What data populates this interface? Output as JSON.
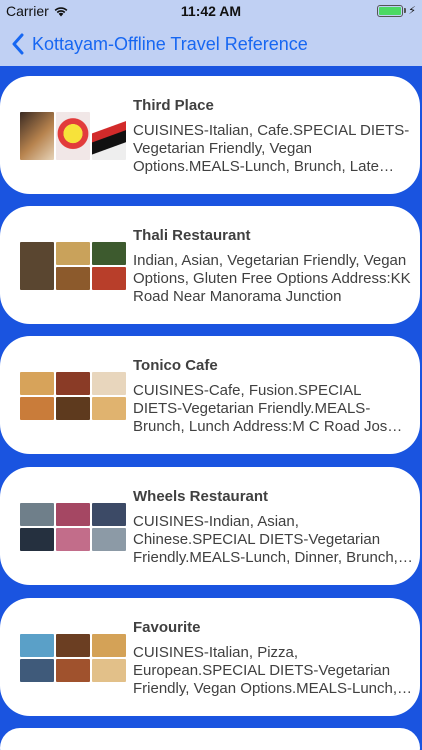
{
  "status": {
    "carrier": "Carrier",
    "time": "11:42 AM"
  },
  "nav": {
    "back_icon": "chevron-left",
    "title": "Kottayam-Offline Travel Reference"
  },
  "items": [
    {
      "title": "Third Place",
      "description": "CUISINES-Italian, Cafe.SPECIAL DIETS-Vegetarian Friendly, Vegan Options.MEALS-Lunch, Brunch, Late Night"
    },
    {
      "title": "Thali Restaurant",
      "description": "Indian, Asian, Vegetarian Friendly, Vegan Options, Gluten Free Options Address:KK Road Near Manorama Junction"
    },
    {
      "title": "Tonico Cafe",
      "description": "CUISINES-Cafe, Fusion.SPECIAL DIETS-Vegetarian Friendly.MEALS-Brunch, Lunch Address:M C Road Jos Junction"
    },
    {
      "title": "Wheels Restaurant",
      "description": "CUISINES-Indian, Asian, Chinese.SPECIAL DIETS-Vegetarian Friendly.MEALS-Lunch, Dinner, Brunch, Late Night"
    },
    {
      "title": "Favourite",
      "description": "CUISINES-Italian, Pizza, European.SPECIAL DIETS-Vegetarian Friendly, Vegan Options.MEALS-Lunch, Dinner"
    }
  ]
}
